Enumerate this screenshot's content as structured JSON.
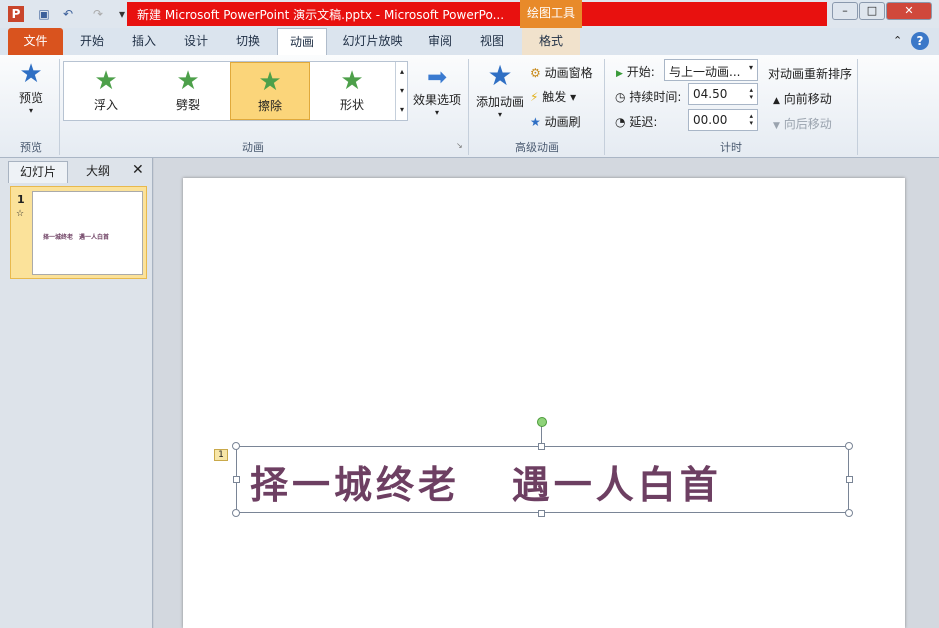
{
  "window": {
    "title": "新建 Microsoft PowerPoint 演示文稿.pptx - Microsoft PowerPo...",
    "context_tab": "绘图工具"
  },
  "tabs": [
    "文件",
    "开始",
    "插入",
    "设计",
    "切换",
    "动画",
    "幻灯片放映",
    "审阅",
    "视图",
    "格式"
  ],
  "ribbon": {
    "preview": {
      "label": "预览",
      "group": "预览"
    },
    "animations": [
      "浮入",
      "劈裂",
      "擦除",
      "形状"
    ],
    "selected_animation": "擦除",
    "effect_options": "效果选项",
    "group_animation": "动画",
    "add_animation": "添加动画",
    "anim_pane": "动画窗格",
    "trigger": "触发",
    "anim_painter": "动画刷",
    "group_advanced": "高级动画",
    "start_label": "开始:",
    "start_value": "与上一动画...",
    "duration_label": "持续时间:",
    "duration_value": "04.50",
    "delay_label": "延迟:",
    "delay_value": "00.00",
    "reorder": "对动画重新排序",
    "move_earlier": "向前移动",
    "move_later": "向后移动",
    "group_timing": "计时"
  },
  "panel": {
    "tab_slides": "幻灯片",
    "tab_outline": "大纲",
    "slide_number": "1",
    "thumb_text": "择一城终老　遇一人白首"
  },
  "slide": {
    "text": "择一城终老   遇一人白首",
    "anim_tag": "1"
  }
}
